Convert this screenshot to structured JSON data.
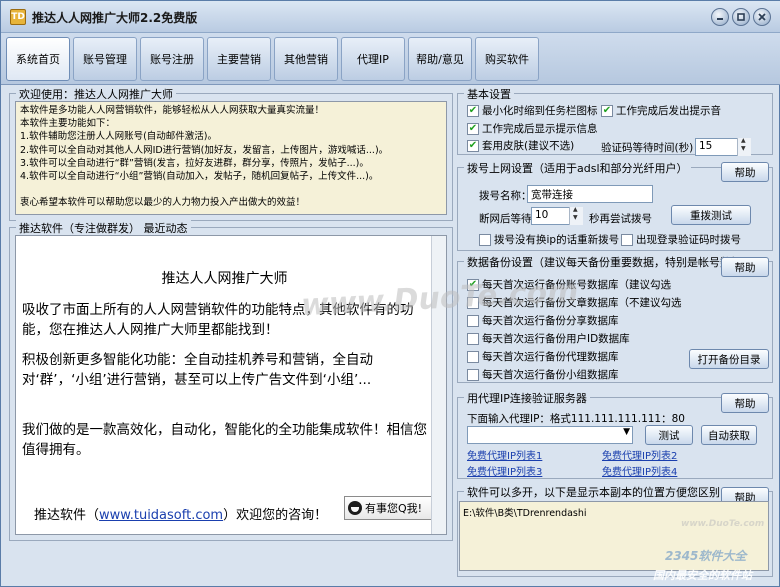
{
  "window": {
    "title": "推达人人网推广大师2.2免费版",
    "app_icon_text": "TD"
  },
  "tabs": [
    {
      "label": "系统首页",
      "active": true
    },
    {
      "label": "账号管理"
    },
    {
      "label": "账号注册"
    },
    {
      "label": "主要营销"
    },
    {
      "label": "其他营销"
    },
    {
      "label": "代理IP"
    },
    {
      "label": "帮助/意见"
    },
    {
      "label": "购买软件"
    }
  ],
  "welcome": {
    "title": "欢迎使用：推达人人网推广大师",
    "text": "本软件是多功能人人网营销软件，能够轻松从人人网获取大量真实流量！\n本软件主要功能如下：\n1.软件辅助您注册人人网账号(自动邮件激活)。\n2.软件可以全自动对其他人人网ID进行营销(加好友，发留言，上传图片，游戏喊话...)。\n3.软件可以全自动进行“群”营销(发言，拉好友进群，群分享，传照片，发帖子...)。\n4.软件可以全自动进行“小组”营销(自动加入，发帖子，随机回复帖子，上传文件...)。\n\n衷心希望本软件可以帮助您以最少的人力物力投入产出做大的效益！"
  },
  "promo": {
    "title": "推达软件（专注做群发） 最近动态",
    "heading": "推达人人网推广大师",
    "p1": "吸收了市面上所有的人人网营销软件的功能特点，其他软件有的功能，您在推达人人网推广大师里都能找到！",
    "p2": "积极创新更多智能化功能：全自动挂机养号和营销，全自动对‘群’，‘小组’进行营销，甚至可以上传广告文件到‘小组’...",
    "p3": "我们做的是一款高效化，自动化，智能化的全功能集成软件！相信您值得拥有。",
    "footer_prefix": "推达软件（",
    "footer_link": "www.tuidasoft.com",
    "footer_suffix": "）欢迎您的咨询！",
    "qq_button": "有事您Q我!"
  },
  "basic": {
    "title": "基本设置",
    "opt1": "最小化时缩到任务栏图标",
    "opt2": "工作完成后发出提示音",
    "opt3": "工作完成后显示提示信息",
    "opt4": "套用皮肤(建议不选)",
    "captcha_label": "验证码等待时间(秒)",
    "captcha_value": "15"
  },
  "dial": {
    "title": "拨号上网设置（适用于adsl和部分光纤用户）",
    "help": "帮助",
    "name_label": "拨号名称：",
    "name_value": "宽带连接",
    "wait_label": "断网后等待",
    "wait_value": "10",
    "retry_label": "秒再尝试拨号",
    "test_button": "重拨测试",
    "opt_new_ip": "拨号没有换ip的话重新拨号",
    "opt_captcha": "出现登录验证码时拨号"
  },
  "backup": {
    "title": "数据备份设置（建议每天备份重要数据，特别是帐号数据）",
    "help": "帮助",
    "items": [
      {
        "label": "每天首次运行备份账号数据库（建议勾选",
        "checked": true
      },
      {
        "label": "每天首次运行备份文章数据库（不建议勾选",
        "checked": false
      },
      {
        "label": "每天首次运行备份分享数据库",
        "checked": false
      },
      {
        "label": "每天首次运行备份用户ID数据库",
        "checked": false
      },
      {
        "label": "每天首次运行备份代理数据库",
        "checked": false
      },
      {
        "label": "每天首次运行备份小组数据库",
        "checked": false
      }
    ],
    "open_button": "打开备份目录"
  },
  "proxy": {
    "title": "用代理IP连接验证服务器",
    "help": "帮助",
    "input_label": "下面输入代理IP：格式111.111.111.111：80",
    "test_button": "测试",
    "auto_button": "自动获取",
    "links": [
      "免费代理IP列表1",
      "免费代理IP列表2",
      "免费代理IP列表3",
      "免费代理IP列表4"
    ]
  },
  "multi": {
    "title": "软件可以多开，以下是显示本副本的位置方便您区别",
    "help": "帮助",
    "path": "E:\\软件\\B类\\TDrenrendashi"
  },
  "watermarks": {
    "center": "www.DuoTe.com",
    "brand": "2345软件大全",
    "brand_sub": "国内最安全的软件站",
    "corner": "www.DuoTe.com"
  }
}
